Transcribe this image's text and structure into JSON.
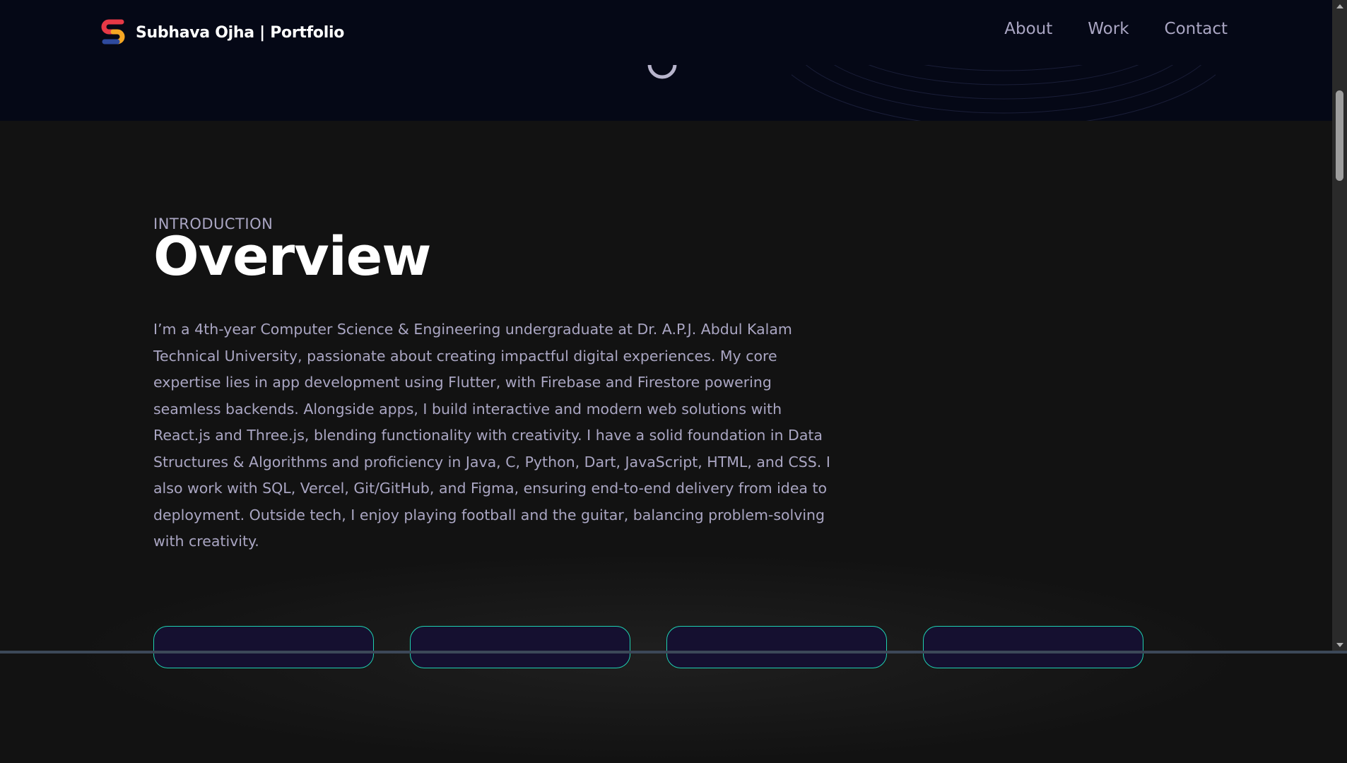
{
  "brand": {
    "name": "Subhava Ojha",
    "suffix": " | Portfolio",
    "logo_icon": "s-logo-icon"
  },
  "nav": {
    "links": [
      {
        "label": "About"
      },
      {
        "label": "Work"
      },
      {
        "label": "Contact"
      }
    ]
  },
  "hero": {
    "loader_icon": "loading-spinner-icon"
  },
  "overview": {
    "eyebrow": "INTRODUCTION",
    "title": "Overview",
    "body": "I’m a 4th-year Computer Science & Engineering undergraduate at Dr. A.P.J. Abdul Kalam Technical University, passionate about creating impactful digital experiences. My core expertise lies in app development using Flutter, with Firebase and Firestore powering seamless backends. Alongside apps, I build interactive and modern web solutions with React.js and Three.js, blending functionality with creativity. I have a solid foundation in Data Structures & Algorithms and proficiency in Java, C, Python, Dart, JavaScript, HTML, and CSS. I also work with SQL, Vercel, Git/GitHub, and Figma, ensuring end-to-end delivery from idea to deployment. Outside tech, I enjoy playing football and the guitar, balancing problem-solving with creativity."
  },
  "colors": {
    "background": "#121212",
    "hero_background": "#050816",
    "heading": "#ffffff",
    "secondary_text": "#aaa6c3",
    "card_border": "#1fd1b0",
    "card_fill": "#151030",
    "logo_red": "#e63946",
    "logo_yellow": "#f5a623",
    "logo_blue": "#2e4a9e"
  },
  "scrollbar": {
    "up_icon": "scroll-up-arrow-icon",
    "down_icon": "scroll-down-arrow-icon"
  }
}
